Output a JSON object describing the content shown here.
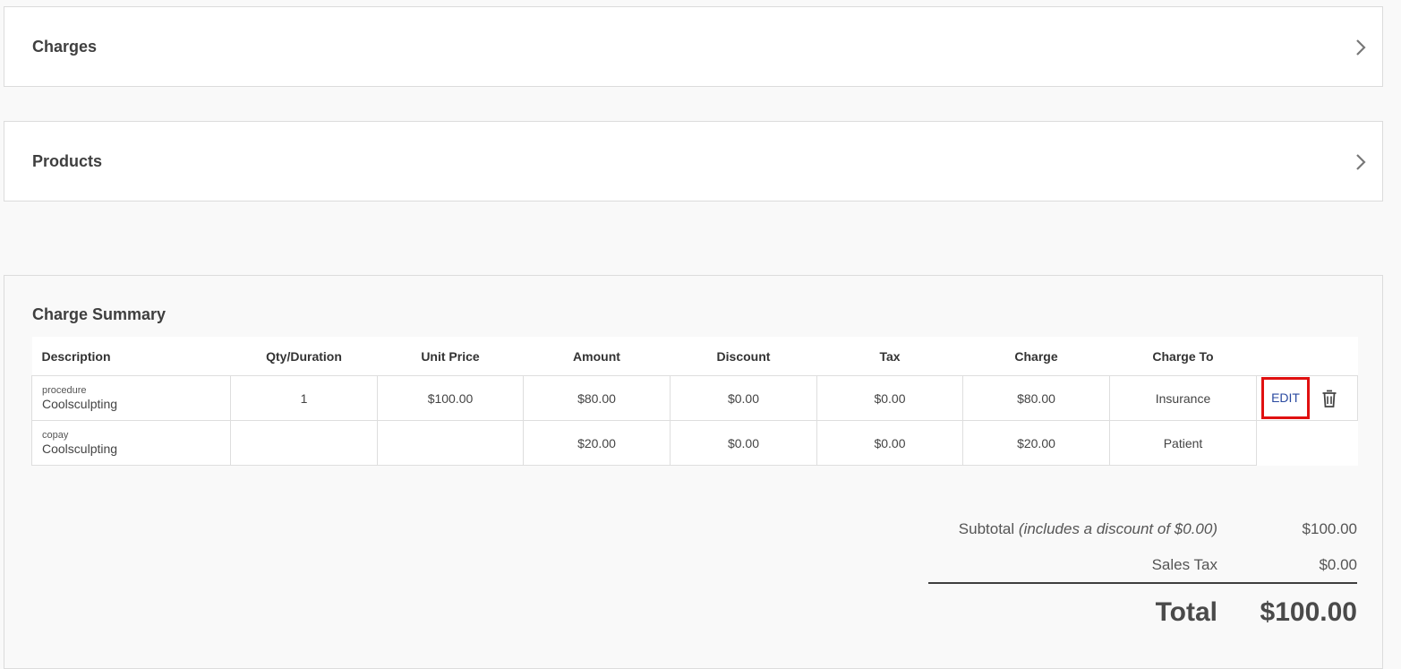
{
  "panels": {
    "charges_label": "Charges",
    "products_label": "Products"
  },
  "summary": {
    "title": "Charge Summary",
    "columns": [
      "Description",
      "Qty/Duration",
      "Unit Price",
      "Amount",
      "Discount",
      "Tax",
      "Charge",
      "Charge To"
    ],
    "rows": [
      {
        "kind": "procedure",
        "name": "Coolsculpting",
        "qty": "1",
        "unit_price": "$100.00",
        "amount": "$80.00",
        "discount": "$0.00",
        "tax": "$0.00",
        "charge": "$80.00",
        "charge_to": "Insurance",
        "edit_label": "EDIT"
      },
      {
        "kind": "copay",
        "name": "Coolsculpting",
        "qty": "",
        "unit_price": "",
        "amount": "$20.00",
        "discount": "$0.00",
        "tax": "$0.00",
        "charge": "$20.00",
        "charge_to": "Patient"
      }
    ]
  },
  "totals": {
    "subtotal_label": "Subtotal",
    "subtotal_note": "(includes a discount of $0.00)",
    "subtotal_value": "$100.00",
    "sales_tax_label": "Sales Tax",
    "sales_tax_value": "$0.00",
    "total_label": "Total",
    "total_value": "$100.00"
  },
  "colors": {
    "edit_highlight": "#e01010",
    "edit_text": "#2a4aa0"
  },
  "icons": {
    "panel_chevron": "chevron-right-icon",
    "row_delete": "trash-icon"
  }
}
